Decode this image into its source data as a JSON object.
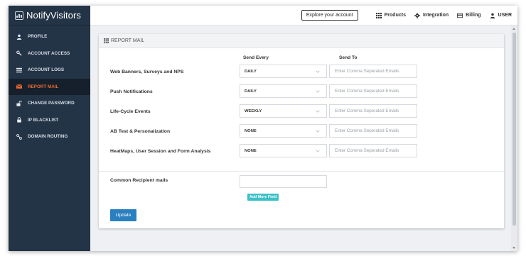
{
  "brand": {
    "name": "NotifyVisitors"
  },
  "sidebar": {
    "items": [
      {
        "label": "PROFILE",
        "icon": "user-icon",
        "active": false
      },
      {
        "label": "ACCOUNT ACCESS",
        "icon": "key-icon",
        "active": false
      },
      {
        "label": "ACCOUNT LOGS",
        "icon": "list-icon",
        "active": false
      },
      {
        "label": "REPORT MAIL",
        "icon": "mail-icon",
        "active": true
      },
      {
        "label": "CHANGE PASSWORD",
        "icon": "unlock-icon",
        "active": false
      },
      {
        "label": "IP BLACKLIST",
        "icon": "lock-icon",
        "active": false
      },
      {
        "label": "DOMAIN ROUTING",
        "icon": "route-icon",
        "active": false
      }
    ]
  },
  "topbar": {
    "explore": "Explore your account",
    "products": "Products",
    "integration": "Integration",
    "billing": "Billing",
    "user": "USER"
  },
  "card": {
    "title": "REPORT MAIL",
    "send_every_header": "Send Every",
    "send_to_header": "Send To",
    "rows": [
      {
        "label": "Web Banners, Surveys and NPS",
        "frequency": "DAILY",
        "email_placeholder": "Enter Comma Seperated Emails"
      },
      {
        "label": "Push Notifications",
        "frequency": "DAILY",
        "email_placeholder": "Enter Comma Seperated Emails"
      },
      {
        "label": "Life-Cycle Events",
        "frequency": "WEEKLY",
        "email_placeholder": "Enter Comma Seperated Emails"
      },
      {
        "label": "AB Test & Personalization",
        "frequency": "NONE",
        "email_placeholder": "Enter Comma Seperated Emails"
      },
      {
        "label": "HeatMaps, User Session and Form Analysis",
        "frequency": "NONE",
        "email_placeholder": "Enter Comma Seperated Emails"
      }
    ],
    "common_label": "Common Recipient mails",
    "common_value": "",
    "add_more": "Add More Field",
    "update": "Update"
  },
  "colors": {
    "sidebar_bg": "#243447",
    "active_item": "#e8682f",
    "primary_button": "#2a7fc0",
    "add_button": "#3cc1c8"
  }
}
